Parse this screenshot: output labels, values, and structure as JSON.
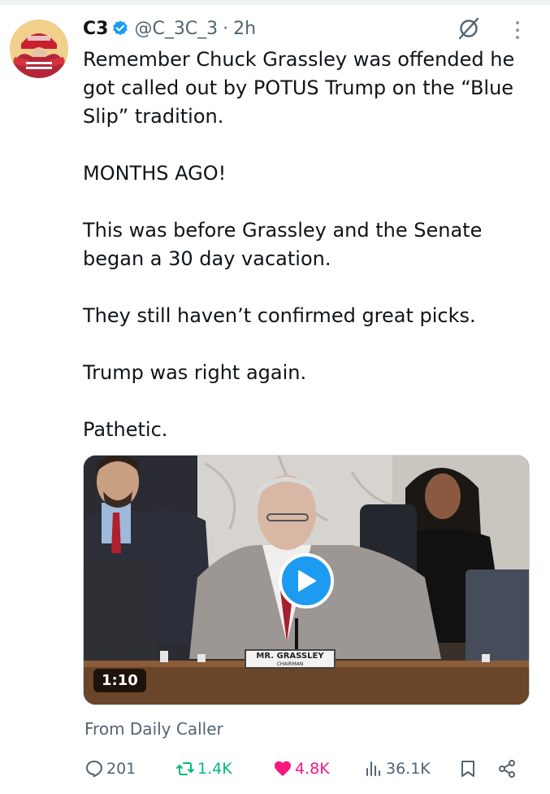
{
  "tweet": {
    "author_name": "C3",
    "handle": "@C_3C_3",
    "separator": "·",
    "time": "2h",
    "paragraphs": [
      "Remember Chuck Grassley was offended he got called out by POTUS Trump on the “Blue Slip” tradition.",
      "MONTHS AGO!",
      "This was before Grassley and the Senate began a 30 day vacation.",
      "They still haven’t confirmed great picks.",
      "Trump was right again.",
      "Pathetic."
    ],
    "media": {
      "duration": "1:10",
      "nameplate_name": "MR. GRASSLEY",
      "nameplate_title": "CHAIRMAN"
    },
    "source": "From Daily Caller",
    "stats": {
      "replies": "201",
      "reposts": "1.4K",
      "likes": "4.8K",
      "views": "36.1K"
    }
  },
  "colors": {
    "verified_blue": "#1d9bf0",
    "repost_green": "#00ba7c",
    "like_pink": "#f91880",
    "secondary_text": "#536471",
    "primary_text": "#0f1419"
  },
  "icons": [
    "verified-badge-icon",
    "grok-icon",
    "more-icon",
    "play-icon",
    "reply-icon",
    "repost-icon",
    "like-icon",
    "views-icon",
    "bookmark-icon",
    "share-icon"
  ]
}
